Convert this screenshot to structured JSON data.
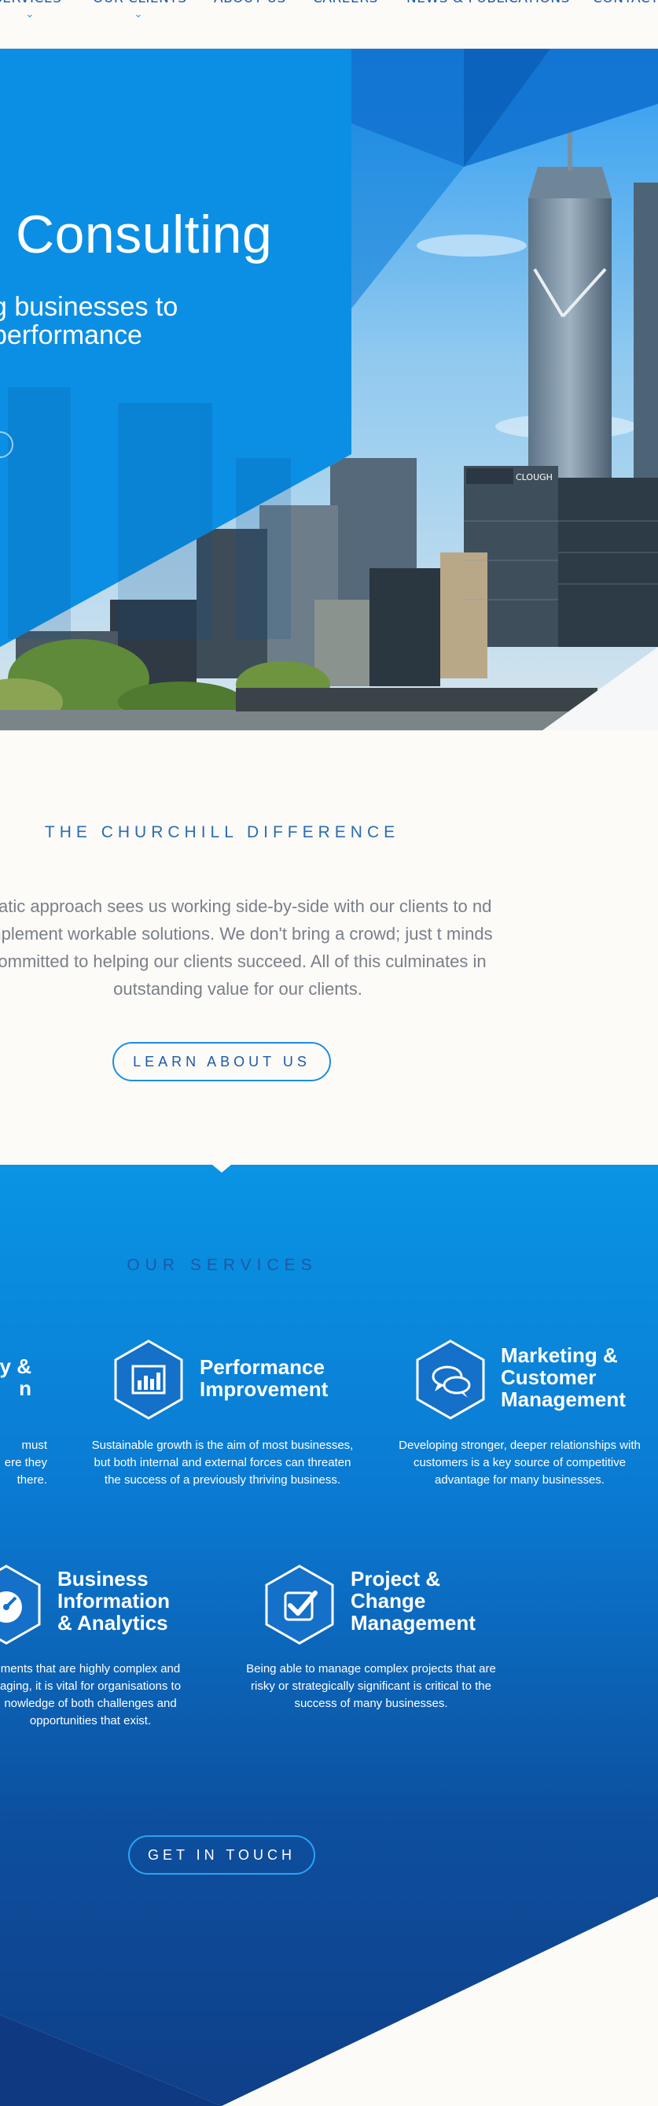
{
  "nav": {
    "items": [
      {
        "label": "SERVICES",
        "chevron": true
      },
      {
        "label": "OUR CLIENTS",
        "chevron": true
      },
      {
        "label": "ABOUT US",
        "chevron": false
      },
      {
        "label": "CAREERS",
        "chevron": false
      },
      {
        "label": "NEWS & PUBLICATIONS",
        "chevron": false
      },
      {
        "label": "CONTACT",
        "chevron": false
      }
    ]
  },
  "hero": {
    "title": "Consulting",
    "subtitle_line1": "g businesses to",
    "subtitle_line2": "performance",
    "building_sign": "CLOUGH"
  },
  "difference": {
    "title": "THE CHURCHILL DIFFERENCE",
    "body": "matic approach sees us working side-by-side with our clients to nd implement workable solutions. We don't bring a crowd; just t minds committed to helping our clients succeed. All of this culminates in outstanding value for our clients.",
    "button_label": "LEARN ABOUT US"
  },
  "services": {
    "title": "OUR SERVICES",
    "items": [
      {
        "icon": "strategy-icon",
        "title": "y &\nn",
        "desc": "must\nere they\nthere."
      },
      {
        "icon": "bar-chart-icon",
        "title": "Performance\nImprovement",
        "desc": "Sustainable growth is the aim of most businesses, but both internal and external forces can threaten the success of a previously thriving business."
      },
      {
        "icon": "speech-bubbles-icon",
        "title": "Marketing &\nCustomer\nManagement",
        "desc": "Developing stronger, deeper relationships with customers is a key source of competitive advantage for many businesses."
      },
      {
        "icon": "dashboard-gauge-icon",
        "title": "Business\nInformation\n& Analytics",
        "desc": "ments that are highly complex and\naging, it is vital for organisations to\nnowledge of both challenges and\nopportunities that exist."
      },
      {
        "icon": "checkbox-icon",
        "title": "Project &\nChange\nManagement",
        "desc": "Being able to manage complex projects that are risky or strategically significant is critical to the success of many businesses."
      }
    ],
    "button_label": "GET IN TOUCH"
  },
  "colors": {
    "brand_blue": "#1d5aa5",
    "accent_blue": "#1f8de0",
    "cream": "#fcfbf8"
  }
}
